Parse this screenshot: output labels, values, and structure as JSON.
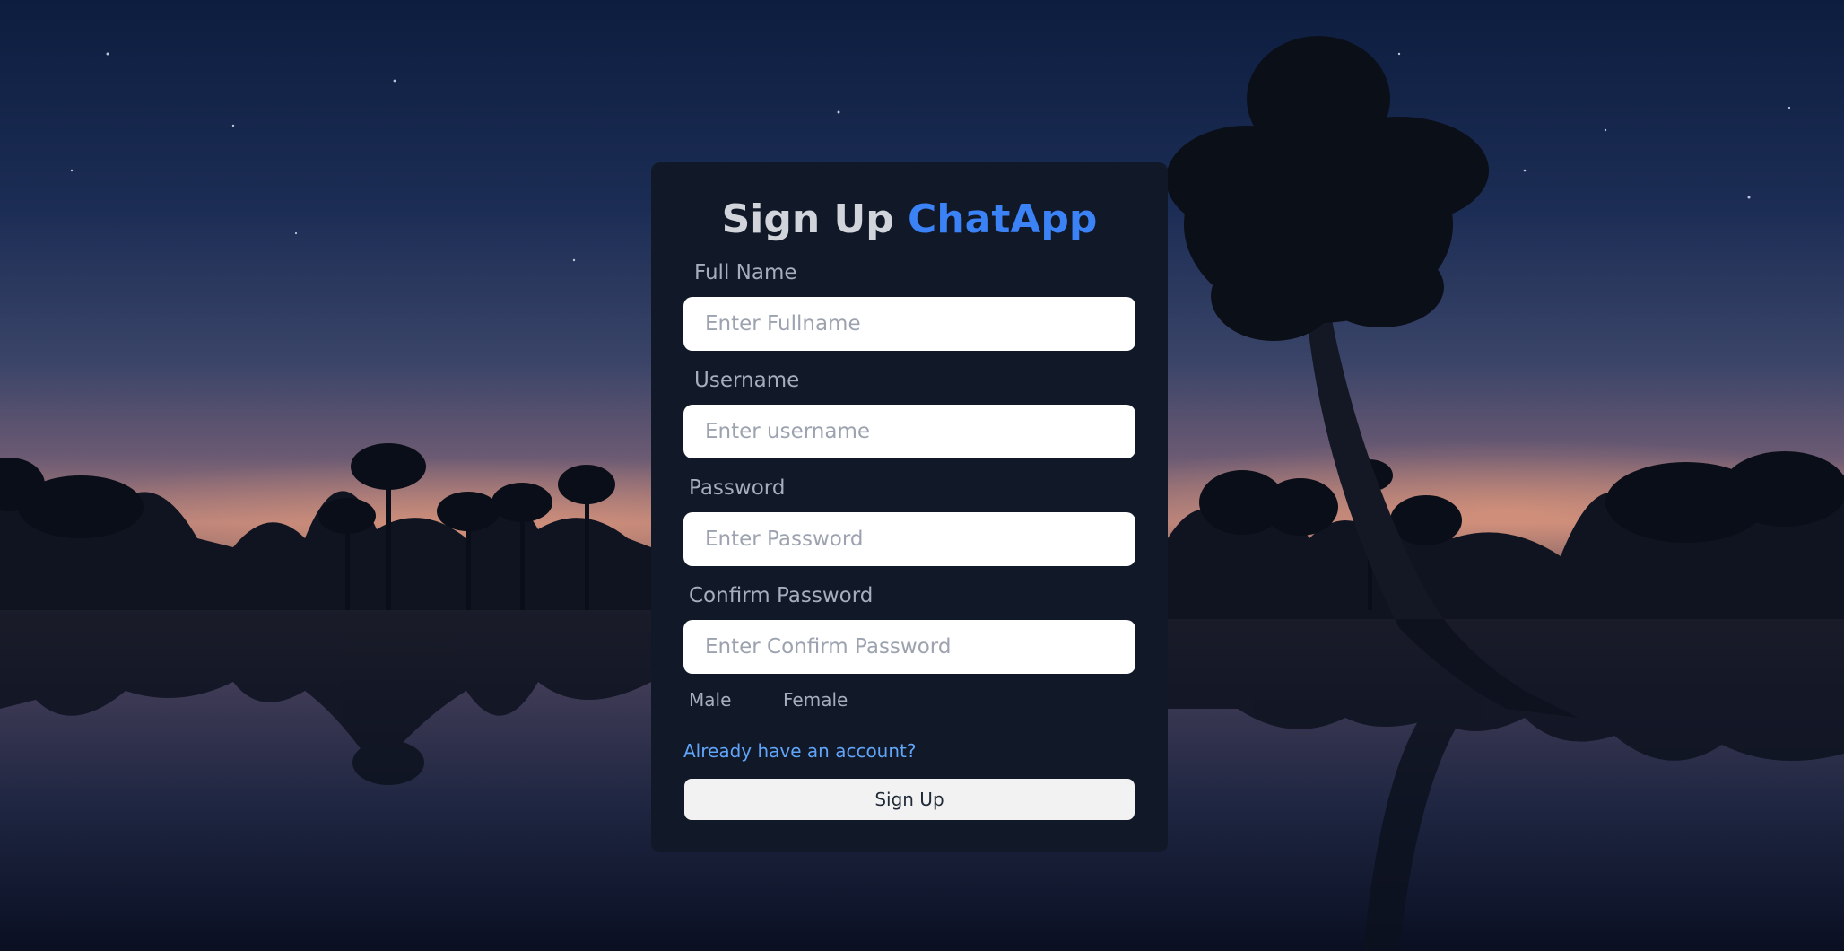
{
  "title": {
    "main": "Sign Up",
    "brand": "ChatApp"
  },
  "fields": [
    {
      "label": "Full Name",
      "placeholder": "Enter Fullname",
      "value": ""
    },
    {
      "label": "Username",
      "placeholder": "Enter username",
      "value": ""
    },
    {
      "label": "Password",
      "placeholder": "Enter Password",
      "value": ""
    },
    {
      "label": "Confirm Password",
      "placeholder": "Enter Confirm Password",
      "value": ""
    }
  ],
  "gender": {
    "options": [
      "Male",
      "Female"
    ]
  },
  "login_link": "Already have an account?",
  "submit_label": "Sign Up",
  "colors": {
    "card": "#111827",
    "brand": "#3b82f6",
    "link": "#60a5fa",
    "button": "#f2f2f2"
  }
}
